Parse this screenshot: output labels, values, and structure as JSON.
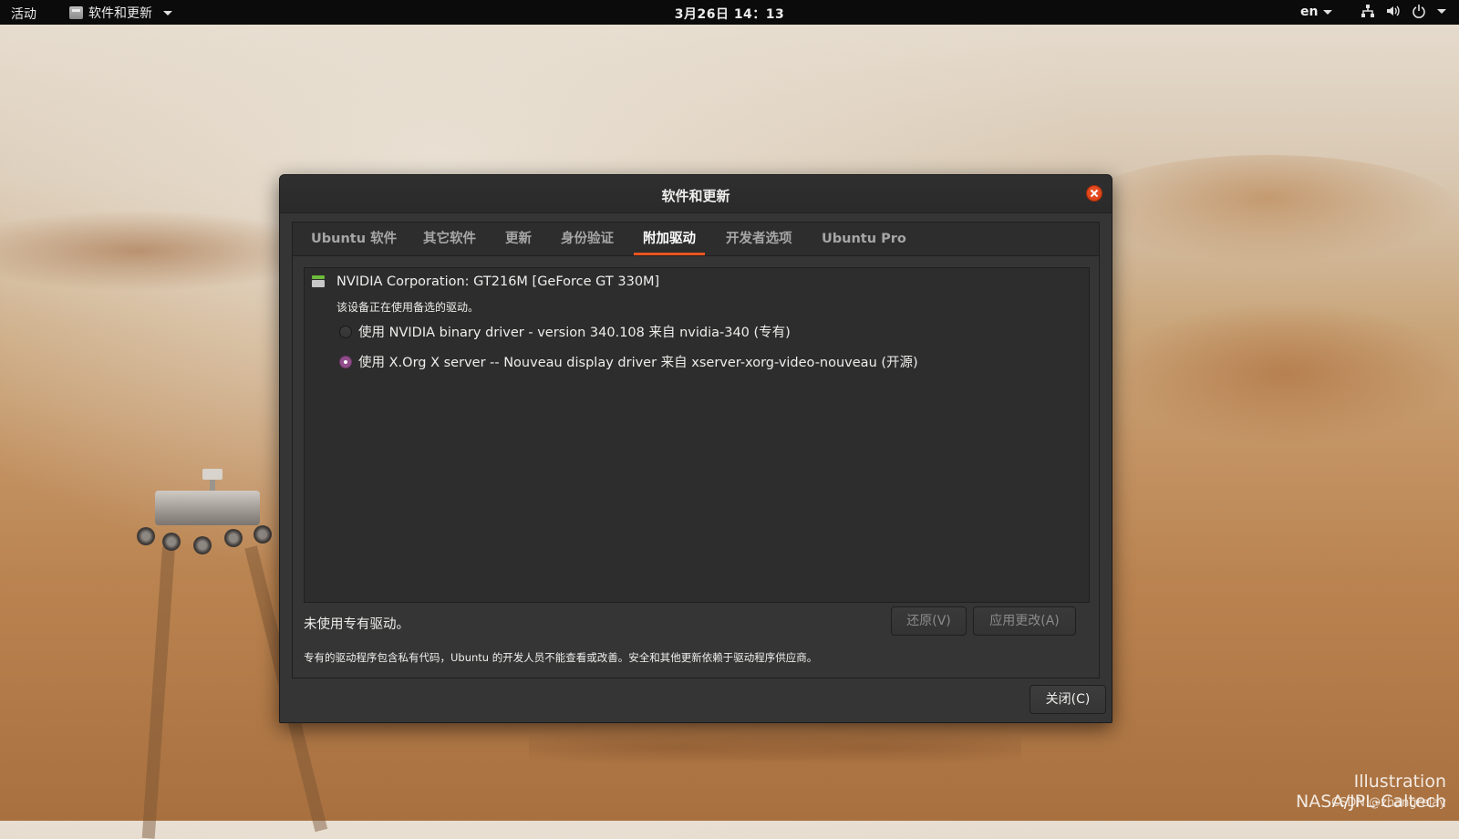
{
  "topbar": {
    "activities": "活动",
    "app_menu": "软件和更新",
    "clock": "3月26日 14：13",
    "language": "en"
  },
  "wallpaper": {
    "credit_line1": "Illustration",
    "credit_line2": "NASA/JPL-Caltech",
    "overlay_watermark": "CSDN @zhangrelay"
  },
  "dialog": {
    "title": "软件和更新",
    "tabs": [
      {
        "label": "Ubuntu 软件"
      },
      {
        "label": "其它软件"
      },
      {
        "label": "更新"
      },
      {
        "label": "身份验证"
      },
      {
        "label": "附加驱动"
      },
      {
        "label": "开发者选项"
      },
      {
        "label": "Ubuntu Pro"
      }
    ],
    "active_tab": "附加驱动",
    "device": {
      "name": "NVIDIA Corporation: GT216M [GeForce GT 330M]",
      "status": "该设备正在使用备选的驱动。",
      "drivers": [
        {
          "label": "使用 NVIDIA binary driver - version 340.108 来自 nvidia-340 (专有)",
          "selected": false
        },
        {
          "label": "使用 X.Org X server -- Nouveau display driver 来自 xserver-xorg-video-nouveau (开源)",
          "selected": true
        }
      ]
    },
    "status_text": "未使用专有驱动。",
    "revert_label": "还原(V)",
    "apply_label": "应用更改(A)",
    "note": "专有的驱动程序包含私有代码，Ubuntu 的开发人员不能查看或改善。安全和其他更新依赖于驱动程序供应商。",
    "close_label": "关闭(C)"
  },
  "colors": {
    "accent": "#e95420",
    "radio_selected": "#924d8b",
    "dialog_bg": "#353535",
    "topbar_bg": "#0b0b0b"
  },
  "icons": [
    "app-icon",
    "network-icon",
    "volume-icon",
    "power-icon",
    "close-icon",
    "gpu-device-icon"
  ]
}
